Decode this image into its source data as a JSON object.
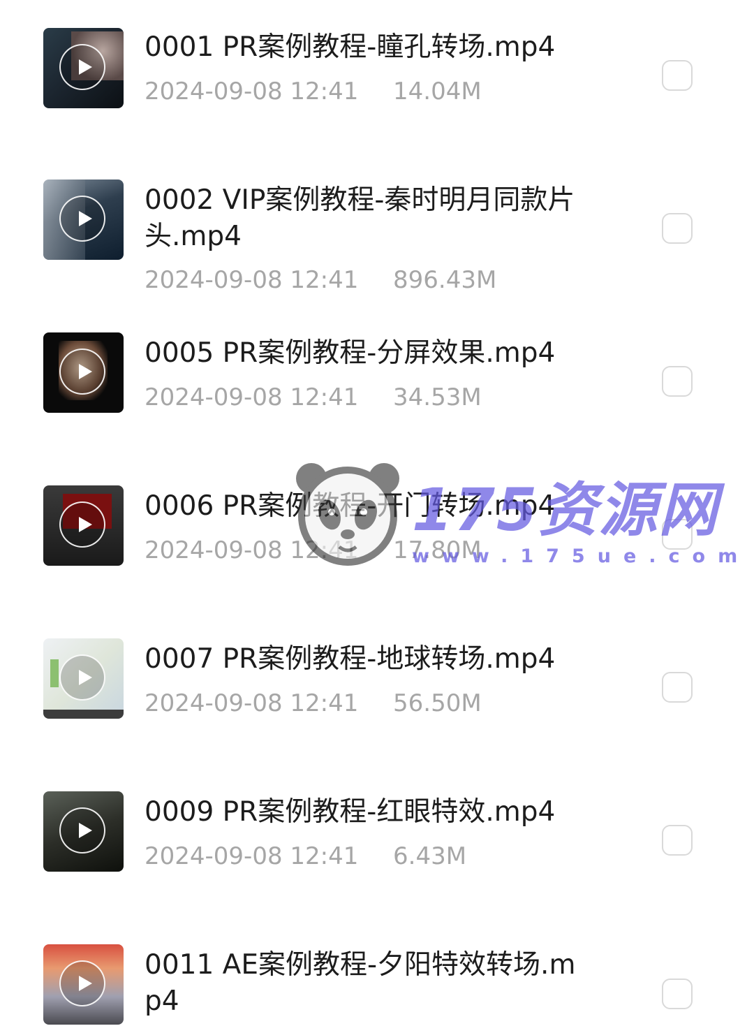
{
  "files": [
    {
      "title": "0001 PR案例教程-瞳孔转场.mp4",
      "date": "2024-09-08 12:41",
      "size": "14.04M",
      "thumb": "t1"
    },
    {
      "title": "0002 VIP案例教程-秦时明月同款片头.mp4",
      "date": "2024-09-08 12:41",
      "size": "896.43M",
      "thumb": "t2"
    },
    {
      "title": "0005 PR案例教程-分屏效果.mp4",
      "date": "2024-09-08 12:41",
      "size": "34.53M",
      "thumb": "t3"
    },
    {
      "title": "0006 PR案例教程-开门转场.mp4",
      "date": "2024-09-08 12:41",
      "size": "17.80M",
      "thumb": "t4"
    },
    {
      "title": "0007 PR案例教程-地球转场.mp4",
      "date": "2024-09-08 12:41",
      "size": "56.50M",
      "thumb": "t5"
    },
    {
      "title": "0009 PR案例教程-红眼特效.mp4",
      "date": "2024-09-08 12:41",
      "size": "6.43M",
      "thumb": "t6"
    },
    {
      "title": "0011 AE案例教程-夕阳特效转场.mp4",
      "date": "",
      "size": "",
      "thumb": "t7"
    }
  ],
  "watermark": {
    "brand": "175资源网",
    "url": "www.175ue.com",
    "icon": "panda-icon"
  },
  "colors": {
    "title": "#1c1c1c",
    "meta": "#a6a6a6",
    "checkbox_border": "#d9d9d9",
    "watermark": "#645ae1"
  }
}
